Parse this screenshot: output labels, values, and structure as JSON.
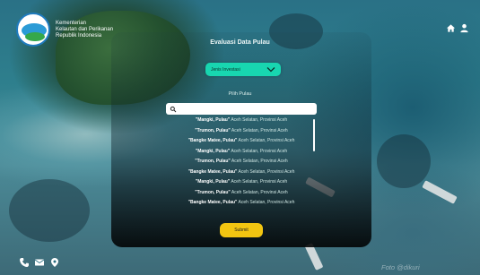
{
  "header": {
    "org_lines": [
      "Kementerian",
      "Kelautan dan Perikanan",
      "Republik Indonesia"
    ],
    "icons": [
      "home-icon",
      "user-icon"
    ]
  },
  "form": {
    "title": "Evaluasi Data Pulau",
    "dropdown_label": "Jenis Investasi",
    "filter_label": "Pilih Pulau",
    "search": {
      "value": "",
      "placeholder": ""
    },
    "results": [
      {
        "name": "\"Mangki, Pulau\"",
        "location": "Aceh Selatan, Provinsi Aceh"
      },
      {
        "name": "\"Trumon, Pulau\"",
        "location": "Aceh Selatan, Provinsi Aceh"
      },
      {
        "name": "\"Bangke Matee, Pulau\"",
        "location": "Aceh Selatan, Provinsi Aceh"
      },
      {
        "name": "\"Mangki, Pulau\"",
        "location": "Aceh Selatan, Provinsi Aceh"
      },
      {
        "name": "\"Trumon, Pulau\"",
        "location": "Aceh Selatan, Provinsi Aceh"
      },
      {
        "name": "\"Bangke Matee, Pulau\"",
        "location": "Aceh Selatan, Provinsi Aceh"
      },
      {
        "name": "\"Mangki, Pulau\"",
        "location": "Aceh Selatan, Provinsi Aceh"
      },
      {
        "name": "\"Trumon, Pulau\"",
        "location": "Aceh Selatan, Provinsi Aceh"
      },
      {
        "name": "\"Bangke Matee, Pulau\"",
        "location": "Aceh Selatan, Provinsi Aceh"
      }
    ],
    "submit_label": "Submit"
  },
  "footer": {
    "icons": [
      "phone-icon",
      "mail-icon",
      "location-pin-icon"
    ]
  },
  "watermark": "Foto @dikuri",
  "colors": {
    "dropdown": "#18d6b0",
    "submit": "#f2c511",
    "text_light": "#ffffff"
  }
}
